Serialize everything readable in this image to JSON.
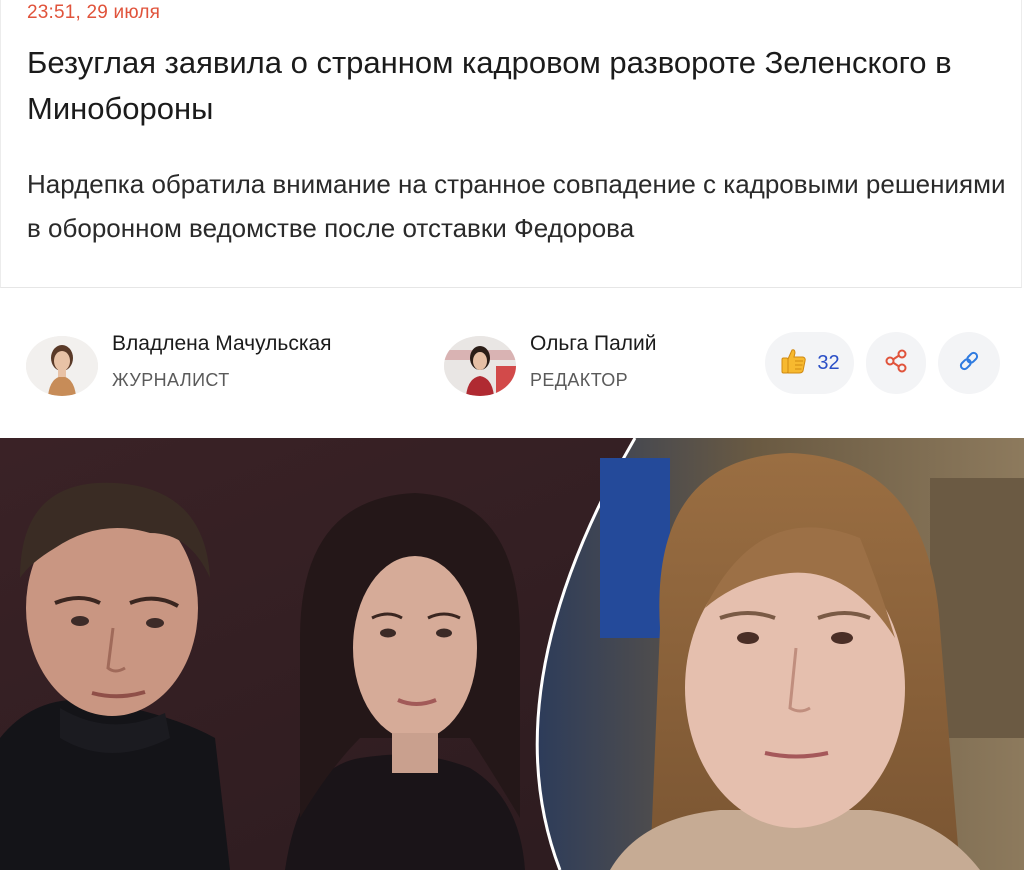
{
  "article": {
    "timestamp": "23:51, 29 июля",
    "headline": "Безуглая заявила о странном кадровом развороте Зеленского в Минобороны",
    "lead": "Нардепка обратила внимание на странное совпадение с кадровыми решениями в оборонном ведомстве после отставки Федорова"
  },
  "authors": [
    {
      "name": "Владлена Мачульская",
      "role": "ЖУРНАЛИСТ"
    },
    {
      "name": "Ольга Палий",
      "role": "РЕДАКТОР"
    }
  ],
  "actions": {
    "like_count": "32",
    "like_icon": "thumbs-up-icon",
    "share_icon": "share-icon",
    "link_icon": "link-icon"
  },
  "colors": {
    "timestamp": "#e0533b",
    "share_icon": "#e0533b",
    "link_icon": "#2f7be0",
    "like_count": "#2a4fc6"
  }
}
